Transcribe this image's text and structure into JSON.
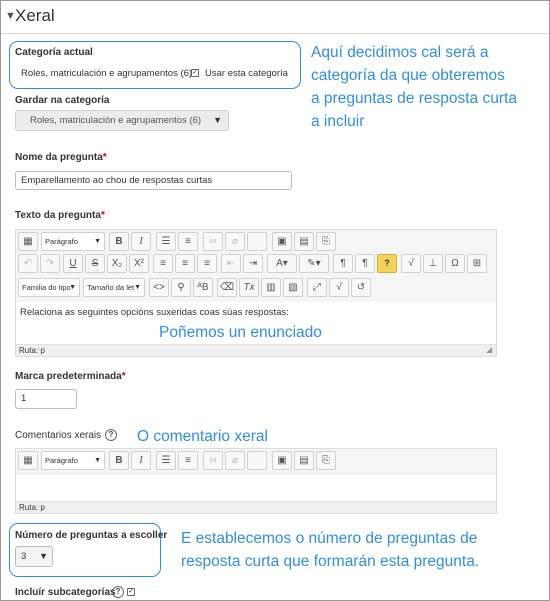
{
  "section": {
    "title": "Xeral"
  },
  "category": {
    "label": "Categoría actual",
    "value": "Roles, matriculación e agrupamentos (6)",
    "use_label": "Usar esta categoría"
  },
  "save_category": {
    "label": "Gardar na categoría",
    "value": "Roles, matriculación e agrupamentos (6)"
  },
  "question_name": {
    "label": "Nome da pregunta",
    "value": "Emparellamento ao chou de respostas curtas"
  },
  "question_text": {
    "label": "Texto da pregunta",
    "paragraph_label": "Parágrafo",
    "font_family_label": "Familia do tipo",
    "font_size_label": "Tamaño da let",
    "content": "Relaciona as seguintes opcións suxeridas coas súas respostas:",
    "path": "Ruta: p"
  },
  "default_mark": {
    "label": "Marca predeterminada",
    "value": "1"
  },
  "general_feedback": {
    "label": "Comentarios xerais",
    "paragraph_label": "Parágrafo",
    "path": "Ruta: p"
  },
  "num_questions": {
    "label": "Número de preguntas a escoller",
    "value": "3"
  },
  "include_subcategories": {
    "label": "Incluír subcategorías"
  },
  "required_mark": "*",
  "annotations": {
    "category_note": [
      "Aquí decidimos cal será a",
      "categoría da que obteremos",
      "a preguntas de resposta curta",
      "a incluir"
    ],
    "statement_note": "Poñemos un enunciado",
    "feedback_note": "O comentario xeral",
    "number_note": [
      "E establecemos o número de preguntas de",
      "resposta curta que formarán esta pregunta."
    ]
  },
  "colors": {
    "accent": "#2f8fd8",
    "required": "#cc0000"
  },
  "icons": [
    "chevron-down-icon",
    "toolbar-toggle-icon",
    "bold-icon",
    "italic-icon",
    "unordered-list-icon",
    "ordered-list-icon",
    "link-icon",
    "unlink-icon",
    "image-icon",
    "media-icon",
    "manage-files-icon",
    "undo-icon",
    "redo-icon",
    "underline-icon",
    "strikethrough-icon",
    "subscript-icon",
    "superscript-icon",
    "align-left-icon",
    "align-center-icon",
    "align-right-icon",
    "outdent-icon",
    "indent-icon",
    "text-color-icon",
    "background-color-icon",
    "ltr-icon",
    "rtl-icon",
    "help-icon",
    "equation-icon",
    "insert-char-icon",
    "omega-icon",
    "table-icon",
    "code-icon",
    "find-icon",
    "abbreviation-icon",
    "clear-format-icon",
    "clear-text-icon",
    "paste-text-icon",
    "paste-word-icon",
    "fullscreen-icon",
    "spellcheck-icon",
    "recover-icon",
    "resize-handle-icon",
    "checkbox-icon"
  ]
}
